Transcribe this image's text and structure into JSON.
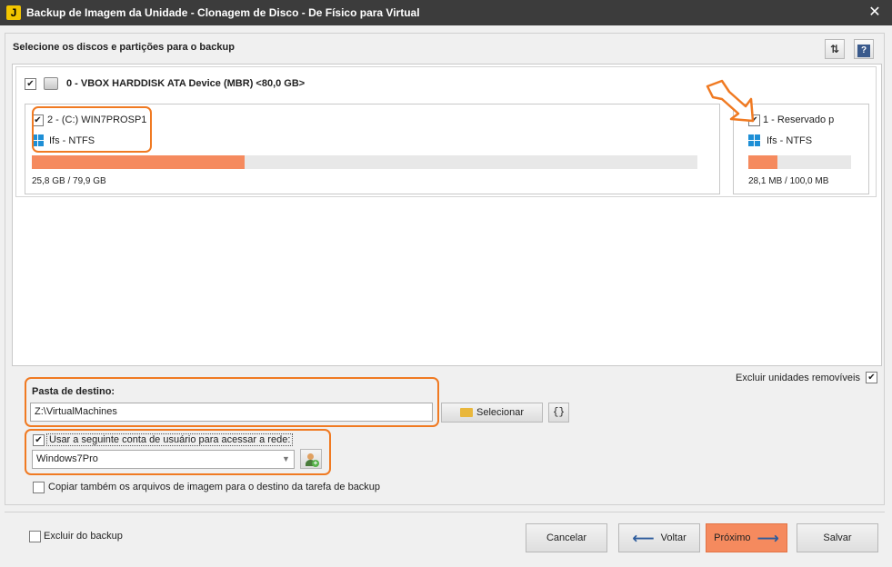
{
  "window": {
    "title": "Backup de Imagem da Unidade - Clonagem de Disco - De Físico para Virtual",
    "app_icon": "J",
    "close_symbol": "✕"
  },
  "main": {
    "section_title": "Selecione os discos e partições para o backup",
    "toolbar": {
      "refresh_icon": "⇅",
      "help_icon": "?"
    },
    "disk": {
      "label": "0 - VBOX HARDDISK ATA Device (MBR) <80,0 GB>",
      "checked": true,
      "partitions": [
        {
          "name": "2 - (C:) WIN7PROSP1",
          "fs": "Ifs - NTFS",
          "size_text": "25,8 GB / 79,9 GB",
          "used_fraction": 0.32,
          "checked": true
        },
        {
          "name": "1 - Reservado p",
          "fs": "Ifs - NTFS",
          "size_text": "28,1 MB / 100,0 MB",
          "used_fraction": 0.28,
          "checked": true
        }
      ]
    },
    "exclude_removable_label": "Excluir unidades removíveis",
    "exclude_removable_checked": true
  },
  "destination": {
    "label": "Pasta de destino:",
    "path": "Z:\\VirtualMachines",
    "select_button": "Selecionar",
    "vars_button": "{}"
  },
  "network": {
    "use_account_label": "Usar a seguinte conta de usuário para acessar a rede:",
    "use_account_checked": true,
    "account": "Windows7Pro"
  },
  "copy_images_label": "Copiar também os arquivos de imagem para o destino da tarefa de backup",
  "copy_images_checked": false,
  "footer": {
    "exclude_backup_label": "Excluir do backup",
    "exclude_backup_checked": false,
    "buttons": {
      "cancel": "Cancelar",
      "back": "Voltar",
      "next": "Próximo",
      "save": "Salvar"
    }
  },
  "colors": {
    "accent_orange": "#f07a22",
    "bar_fill": "#f58a5e",
    "titlebar": "#3c3c3c"
  }
}
